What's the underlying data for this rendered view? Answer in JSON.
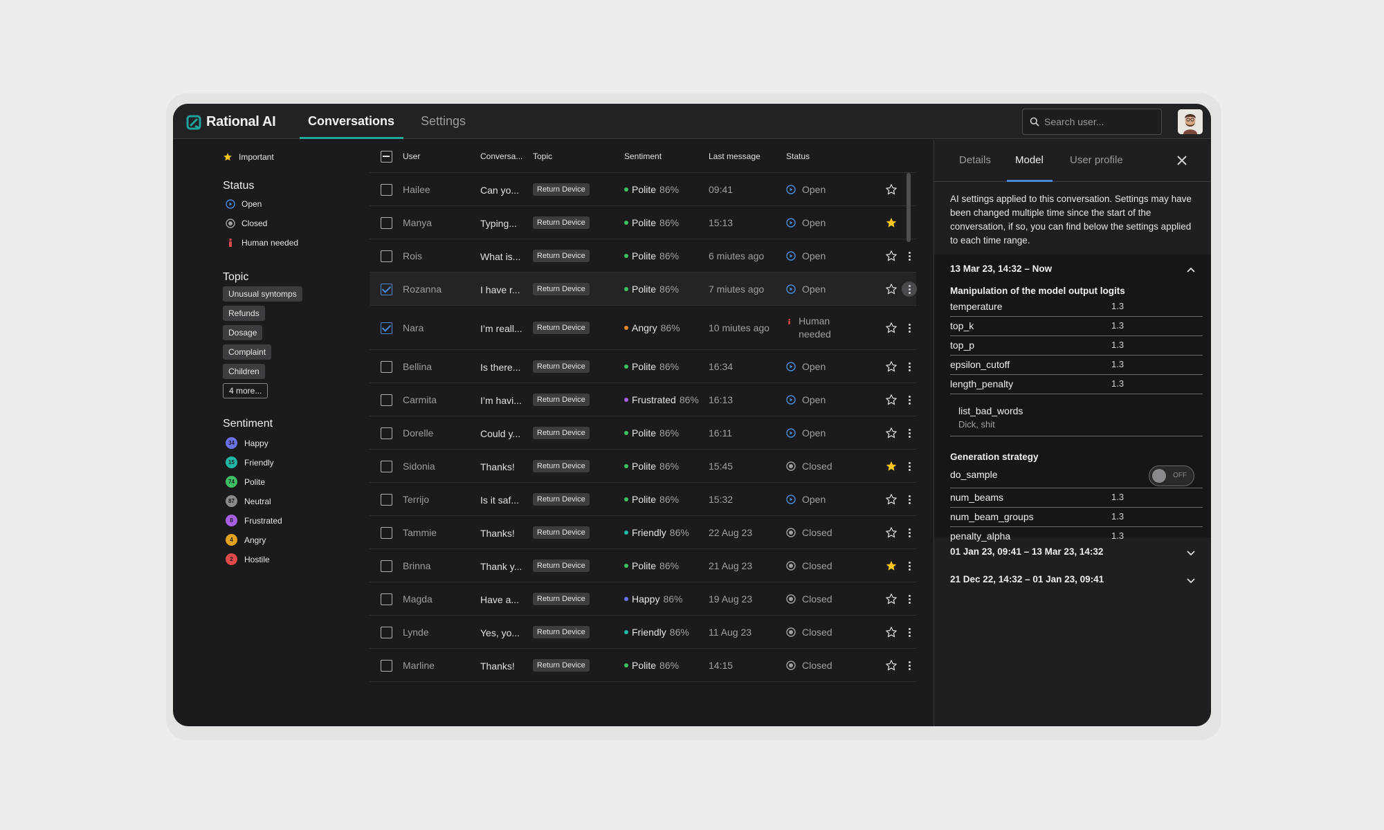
{
  "app": {
    "brand": "Rational AI",
    "nav": [
      {
        "label": "Conversations",
        "active": true
      },
      {
        "label": "Settings",
        "active": false
      }
    ],
    "search_placeholder": "Search user...",
    "accent": "#1fa39a"
  },
  "filters": {
    "important_label": "Important",
    "status_heading": "Status",
    "status_items": [
      {
        "label": "Open",
        "icon": "open-status-icon"
      },
      {
        "label": "Closed",
        "icon": "closed-status-icon"
      },
      {
        "label": "Human needed",
        "icon": "human-needed-icon"
      }
    ],
    "topic_heading": "Topic",
    "topics": [
      "Unusual syntomps",
      "Refunds",
      "Dosage",
      "Complaint",
      "Children"
    ],
    "topics_more": "4 more...",
    "sentiment_heading": "Sentiment",
    "sentiments": [
      {
        "label": "Happy",
        "count": "34",
        "color": "#6b72e8"
      },
      {
        "label": "Friendly",
        "count": "15",
        "color": "#1fb8a6"
      },
      {
        "label": "Polite",
        "count": "74",
        "color": "#3fbf64"
      },
      {
        "label": "Neutral",
        "count": "87",
        "color": "#8a8a8e"
      },
      {
        "label": "Frustrated",
        "count": "8",
        "color": "#a55fe0"
      },
      {
        "label": "Angry",
        "count": "4",
        "color": "#e0a21f"
      },
      {
        "label": "Hostile",
        "count": "2",
        "color": "#e04a4a"
      }
    ]
  },
  "table": {
    "headers": {
      "user": "User",
      "conversation": "Conversa...",
      "topic": "Topic",
      "sentiment": "Sentiment",
      "last_message": "Last message",
      "status": "Status"
    },
    "rows": [
      {
        "user": "Hailee",
        "conv": "Can yo...",
        "topic": "Return Device",
        "sentiment": "Polite",
        "sent_color": "#3fbf64",
        "pct": "86%",
        "last": "09:41",
        "status": "Open",
        "status_type": "open",
        "starred": false,
        "checked": false
      },
      {
        "user": "Manya",
        "conv": "Typing...",
        "topic": "Return Device",
        "sentiment": "Polite",
        "sent_color": "#3fbf64",
        "pct": "86%",
        "last": "15:13",
        "status": "Open",
        "status_type": "open",
        "starred": true,
        "checked": false
      },
      {
        "user": "Rois",
        "conv": "What is...",
        "topic": "Return Device",
        "sentiment": "Polite",
        "sent_color": "#3fbf64",
        "pct": "86%",
        "last": "6 miutes ago",
        "status": "Open",
        "status_type": "open",
        "starred": false,
        "checked": false
      },
      {
        "user": "Rozanna",
        "conv": "I have r...",
        "topic": "Return Device",
        "sentiment": "Polite",
        "sent_color": "#3fbf64",
        "pct": "86%",
        "last": "7 miutes ago",
        "status": "Open",
        "status_type": "open",
        "starred": false,
        "checked": true,
        "selected": true
      },
      {
        "user": "Nara",
        "conv": "I’m reall...",
        "topic": "Return Device",
        "sentiment": "Angry",
        "sent_color": "#e0872f",
        "pct": "86%",
        "last": "10 miutes ago",
        "status": "Human needed",
        "status_type": "human",
        "starred": false,
        "checked": true
      },
      {
        "user": "Bellina",
        "conv": "Is there...",
        "topic": "Return Device",
        "sentiment": "Polite",
        "sent_color": "#3fbf64",
        "pct": "86%",
        "last": "16:34",
        "status": "Open",
        "status_type": "open",
        "starred": false,
        "checked": false
      },
      {
        "user": "Carmita",
        "conv": "I’m havi...",
        "topic": "Return Device",
        "sentiment": "Frustrated",
        "sent_color": "#a55fe0",
        "pct": "86%",
        "last": "16:13",
        "status": "Open",
        "status_type": "open",
        "starred": false,
        "checked": false
      },
      {
        "user": "Dorelle",
        "conv": "Could y...",
        "topic": "Return Device",
        "sentiment": "Polite",
        "sent_color": "#3fbf64",
        "pct": "86%",
        "last": "16:11",
        "status": "Open",
        "status_type": "open",
        "starred": false,
        "checked": false
      },
      {
        "user": "Sidonia",
        "conv": "Thanks!",
        "topic": "Return Device",
        "sentiment": "Polite",
        "sent_color": "#3fbf64",
        "pct": "86%",
        "last": "15:45",
        "status": "Closed",
        "status_type": "closed",
        "starred": true,
        "checked": false
      },
      {
        "user": "Terrijo",
        "conv": "Is it saf...",
        "topic": "Return Device",
        "sentiment": "Polite",
        "sent_color": "#3fbf64",
        "pct": "86%",
        "last": "15:32",
        "status": "Open",
        "status_type": "open",
        "starred": false,
        "checked": false
      },
      {
        "user": "Tammie",
        "conv": "Thanks!",
        "topic": "Return Device",
        "sentiment": "Friendly",
        "sent_color": "#1fb8a6",
        "pct": "86%",
        "last": "22 Aug 23",
        "status": "Closed",
        "status_type": "closed",
        "starred": false,
        "checked": false
      },
      {
        "user": "Brinna",
        "conv": "Thank y...",
        "topic": "Return Device",
        "sentiment": "Polite",
        "sent_color": "#3fbf64",
        "pct": "86%",
        "last": "21 Aug 23",
        "status": "Closed",
        "status_type": "closed",
        "starred": true,
        "checked": false
      },
      {
        "user": "Magda",
        "conv": "Have a...",
        "topic": "Return Device",
        "sentiment": "Happy",
        "sent_color": "#6b72e8",
        "pct": "86%",
        "last": "19 Aug 23",
        "status": "Closed",
        "status_type": "closed",
        "starred": false,
        "checked": false
      },
      {
        "user": "Lynde",
        "conv": "Yes, yo...",
        "topic": "Return Device",
        "sentiment": "Friendly",
        "sent_color": "#1fb8a6",
        "pct": "86%",
        "last": "11 Aug 23",
        "status": "Closed",
        "status_type": "closed",
        "starred": false,
        "checked": false
      },
      {
        "user": "Marline",
        "conv": "Thanks!",
        "topic": "Return Device",
        "sentiment": "Polite",
        "sent_color": "#3fbf64",
        "pct": "86%",
        "last": "14:15",
        "status": "Closed",
        "status_type": "closed",
        "starred": false,
        "checked": false
      }
    ]
  },
  "panel": {
    "tabs": [
      {
        "label": "Details",
        "active": false
      },
      {
        "label": "Model",
        "active": true
      },
      {
        "label": "User profile",
        "active": false
      }
    ],
    "intro": "AI settings applied to this conversation. Settings may have been changed multiple time since the start of the conversation, if so, you can find below the settings applied to each time range.",
    "ranges": [
      {
        "label": "13 Mar 23, 14:32 – Now",
        "expanded": true
      },
      {
        "label": "01 Jan 23, 09:41 – 13 Mar 23, 14:32",
        "expanded": false
      },
      {
        "label": "21 Dec 22, 14:32 – 01 Jan 23, 09:41",
        "expanded": false
      }
    ],
    "logits_title": "Manipulation of the model output logits",
    "logits": [
      {
        "k": "temperature",
        "v": "1.3"
      },
      {
        "k": "top_k",
        "v": "1.3"
      },
      {
        "k": "top_p",
        "v": "1.3"
      },
      {
        "k": "epsilon_cutoff",
        "v": "1.3"
      },
      {
        "k": "length_penalty",
        "v": "1.3"
      }
    ],
    "bad_words": {
      "k": "list_bad_words",
      "v": "Dick, shit"
    },
    "gen_title": "Generation strategy",
    "do_sample": {
      "k": "do_sample",
      "state": "OFF"
    },
    "gen": [
      {
        "k": "num_beams",
        "v": "1.3"
      },
      {
        "k": "num_beam_groups",
        "v": "1.3"
      },
      {
        "k": "penalty_alpha",
        "v": "1.3"
      }
    ]
  }
}
